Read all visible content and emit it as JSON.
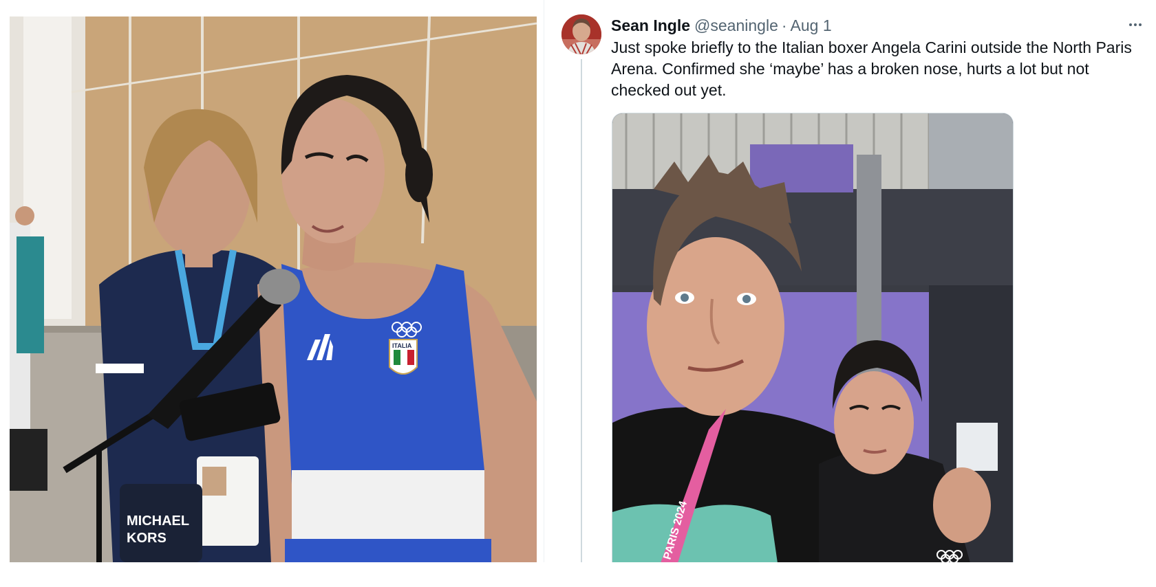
{
  "left_photo": {
    "alt": "",
    "kit_text": "ITALIA",
    "bag_text": "MICHAEL KORS"
  },
  "tweet": {
    "author": {
      "display_name": "Sean Ingle",
      "handle": "@seaningle"
    },
    "separator": "·",
    "date": "Aug 1",
    "more_icon": "ellipsis-icon",
    "text": "Just spoke briefly to the Italian boxer Angela Carini outside the North Paris Arena. Confirmed she ‘maybe’ has a broken nose, hurts a lot but not checked out yet.",
    "media": {
      "lanyard_text": "PARIS 2024"
    }
  },
  "colors": {
    "text_primary": "#0f1419",
    "text_secondary": "#536471",
    "thread_line": "#cfd9de",
    "italy_blue": "#2f55c6",
    "arena_purple": "#8674c9"
  }
}
